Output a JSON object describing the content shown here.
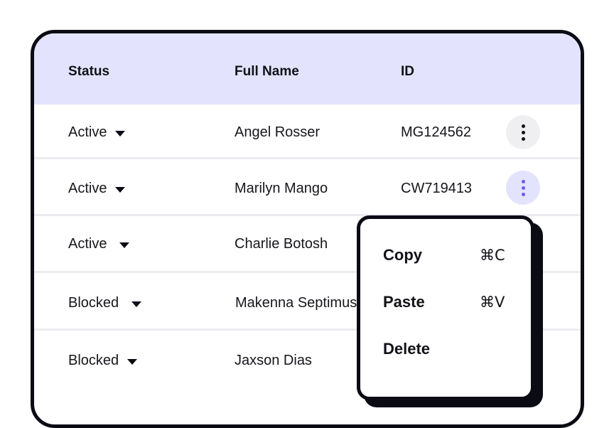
{
  "table": {
    "headers": {
      "status": "Status",
      "full_name": "Full Name",
      "id": "ID"
    },
    "rows": [
      {
        "status": "Active",
        "name": "Angel Rosser",
        "id": "MG124562",
        "menu_open": false
      },
      {
        "status": "Active",
        "name": "Marilyn Mango",
        "id": "CW719413",
        "menu_open": true
      },
      {
        "status": "Active",
        "name": "Charlie Botosh",
        "id": "",
        "menu_open": false
      },
      {
        "status": "Blocked",
        "name": "Makenna Septimus",
        "id": "",
        "menu_open": false
      },
      {
        "status": "Blocked",
        "name": "Jaxson Dias",
        "id": "",
        "menu_open": false
      }
    ]
  },
  "context_menu": {
    "items": [
      {
        "label": "Copy",
        "shortcut": "⌘C"
      },
      {
        "label": "Paste",
        "shortcut": "⌘V"
      },
      {
        "label": "Delete",
        "shortcut": ""
      }
    ]
  },
  "colors": {
    "header_bg": "#e3e3fd",
    "accent": "#6b5cf0",
    "border": "#0b0b14"
  },
  "icons": {
    "row_action": "more-vertical-icon",
    "status_toggle": "caret-down-icon"
  }
}
